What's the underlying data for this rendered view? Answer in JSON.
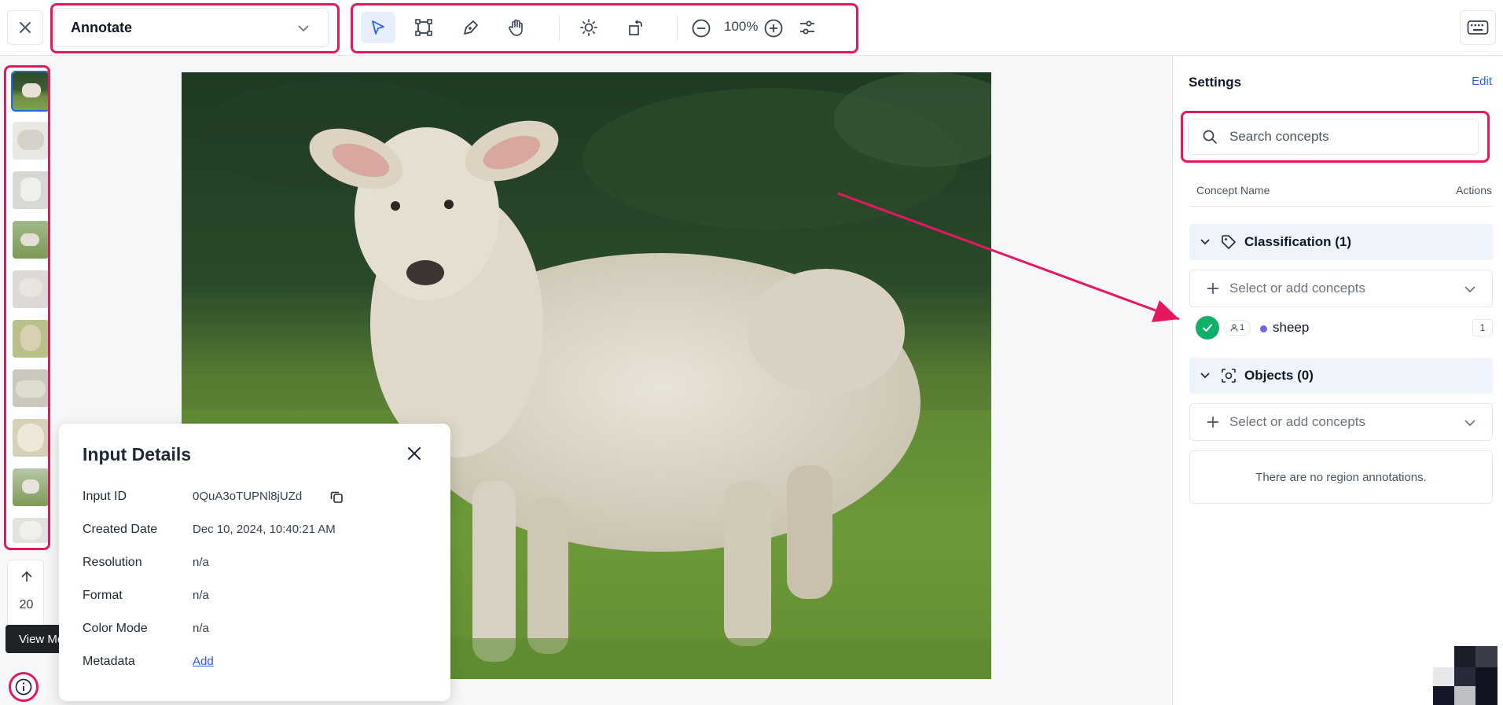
{
  "header": {
    "mode_select": "Annotate",
    "zoom": "100%"
  },
  "rail": {
    "counter": "20",
    "tooltip": "View Metadata"
  },
  "input_details": {
    "title": "Input Details",
    "rows": [
      {
        "label": "Input ID",
        "value": "0QuA3oTUPNl8jUZd"
      },
      {
        "label": "Created Date",
        "value": "Dec 10, 2024, 10:40:21 AM"
      },
      {
        "label": "Resolution",
        "value": "n/a"
      },
      {
        "label": "Format",
        "value": "n/a"
      },
      {
        "label": "Color Mode",
        "value": "n/a"
      },
      {
        "label": "Metadata",
        "value": "Add"
      }
    ]
  },
  "panel": {
    "title": "Settings",
    "edit": "Edit",
    "search_placeholder": "Search concepts",
    "col_concept": "Concept Name",
    "col_actions": "Actions",
    "classification": {
      "title": "Classification (1)",
      "add_placeholder": "Select or add concepts",
      "concept": {
        "name": "sheep",
        "users": "1",
        "count": "1",
        "color": "#7066e0"
      }
    },
    "objects": {
      "title": "Objects (0)",
      "add_placeholder": "Select or add concepts",
      "empty": "There are no region annotations."
    }
  },
  "colors": {
    "highlight": "#e5175f",
    "accent": "#2563eb",
    "check": "#10b068"
  }
}
